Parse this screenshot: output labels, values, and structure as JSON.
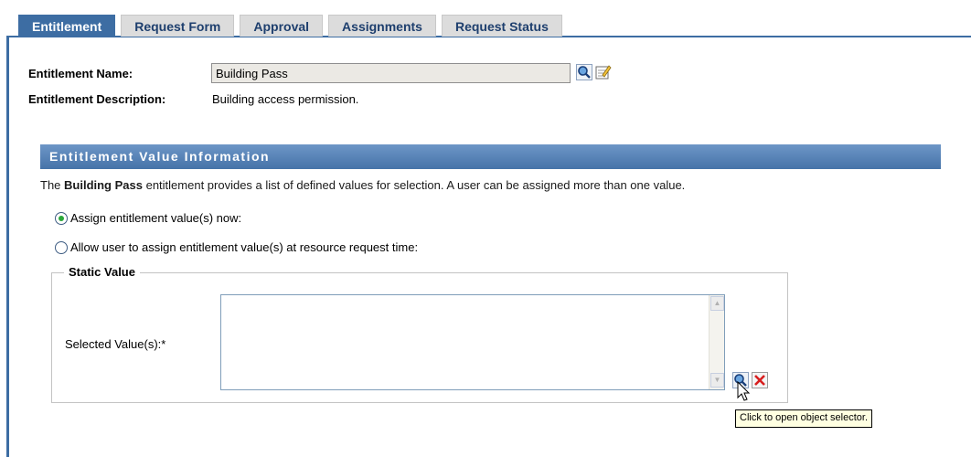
{
  "tabs": [
    {
      "label": "Entitlement",
      "active": true
    },
    {
      "label": "Request Form",
      "active": false
    },
    {
      "label": "Approval",
      "active": false
    },
    {
      "label": "Assignments",
      "active": false
    },
    {
      "label": "Request Status",
      "active": false
    }
  ],
  "entitlement": {
    "name_label": "Entitlement Name:",
    "name_value": "Building Pass",
    "description_label": "Entitlement Description:",
    "description_value": "Building access permission."
  },
  "value_info": {
    "header": "Entitlement Value Information",
    "intro_prefix": "The ",
    "intro_bold": "Building Pass",
    "intro_suffix": " entitlement provides a list of defined values for selection. A user can be assigned more than one value.",
    "option_now": "Assign entitlement value(s) now:",
    "option_request": "Allow user to assign entitlement value(s) at resource request time:",
    "selected_option": "now"
  },
  "static_value": {
    "legend": "Static Value",
    "selected_label": "Selected Value(s):*",
    "selected_values": ""
  },
  "tooltip": "Click to open object selector.",
  "icons": {
    "lookup": "magnifier-icon",
    "edit": "edit-icon",
    "remove": "delete-x-icon"
  },
  "colors": {
    "tab_active": "#3d6da3",
    "header": "#4673a8",
    "remove_icon": "#d81e1e"
  }
}
